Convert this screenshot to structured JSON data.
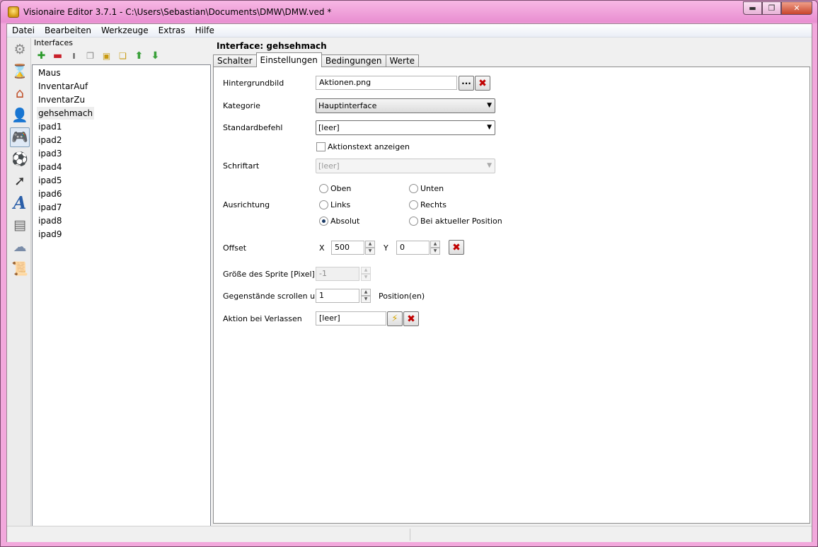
{
  "window": {
    "title": "Visionaire Editor 3.7.1 - C:\\Users\\Sebastian\\Documents\\DMW\\DMW.ved *",
    "minimize": "▬",
    "maximize": "❐",
    "close": "✕"
  },
  "menu": [
    "Datei",
    "Bearbeiten",
    "Werkzeuge",
    "Extras",
    "Hilfe"
  ],
  "sidebar_icons": [
    "gear-icon",
    "hourglass-icon",
    "house-icon",
    "person-icon",
    "gamepad-icon",
    "ball-icon",
    "cursor-icon",
    "font-icon",
    "document-icon",
    "weather-icon",
    "script-icon"
  ],
  "left_panel": {
    "label": "Interfaces",
    "toolbar": [
      "add-icon",
      "remove-icon",
      "rename-icon",
      "copy-icon",
      "paste-icon",
      "duplicate-icon",
      "move-up-icon",
      "move-down-icon"
    ],
    "items": [
      "Maus",
      "InventarAuf",
      "InventarZu",
      "gehsehmach",
      "ipad1",
      "ipad2",
      "ipad3",
      "ipad4",
      "ipad5",
      "ipad6",
      "ipad7",
      "ipad8",
      "ipad9"
    ],
    "selected": "gehsehmach"
  },
  "right_panel": {
    "title": "Interface: gehsehmach",
    "tabs": [
      "Schalter",
      "Einstellungen",
      "Bedingungen",
      "Werte"
    ],
    "active_tab": "Einstellungen",
    "form": {
      "hintergrundbild_label": "Hintergrundbild",
      "hintergrundbild_value": "Aktionen.png",
      "browse_label": "···",
      "kategorie_label": "Kategorie",
      "kategorie_value": "Hauptinterface",
      "standardbefehl_label": "Standardbefehl",
      "standardbefehl_value": "[leer]",
      "aktionstext_label": "Aktionstext anzeigen",
      "aktionstext_checked": false,
      "schriftart_label": "Schriftart",
      "schriftart_value": "[leer]",
      "ausrichtung_label": "Ausrichtung",
      "ausrichtung_options": [
        "Oben",
        "Unten",
        "Links",
        "Rechts",
        "Absolut",
        "Bei aktueller Position"
      ],
      "ausrichtung_selected": "Absolut",
      "offset_label": "Offset",
      "offset_x_label": "X",
      "offset_x_value": "500",
      "offset_y_label": "Y",
      "offset_y_value": "0",
      "sprite_label": "Größe des Sprite [Pixel]",
      "sprite_value": "-1",
      "scroll_label": "Gegenstände scrollen um",
      "scroll_value": "1",
      "scroll_unit": "Position(en)",
      "verlassen_label": "Aktion bei Verlassen",
      "verlassen_value": "[leer]"
    }
  },
  "colors": {
    "frame": "#f2a8dc",
    "delete_icon": "#c00000",
    "radio_dot": "#1b3b66"
  }
}
